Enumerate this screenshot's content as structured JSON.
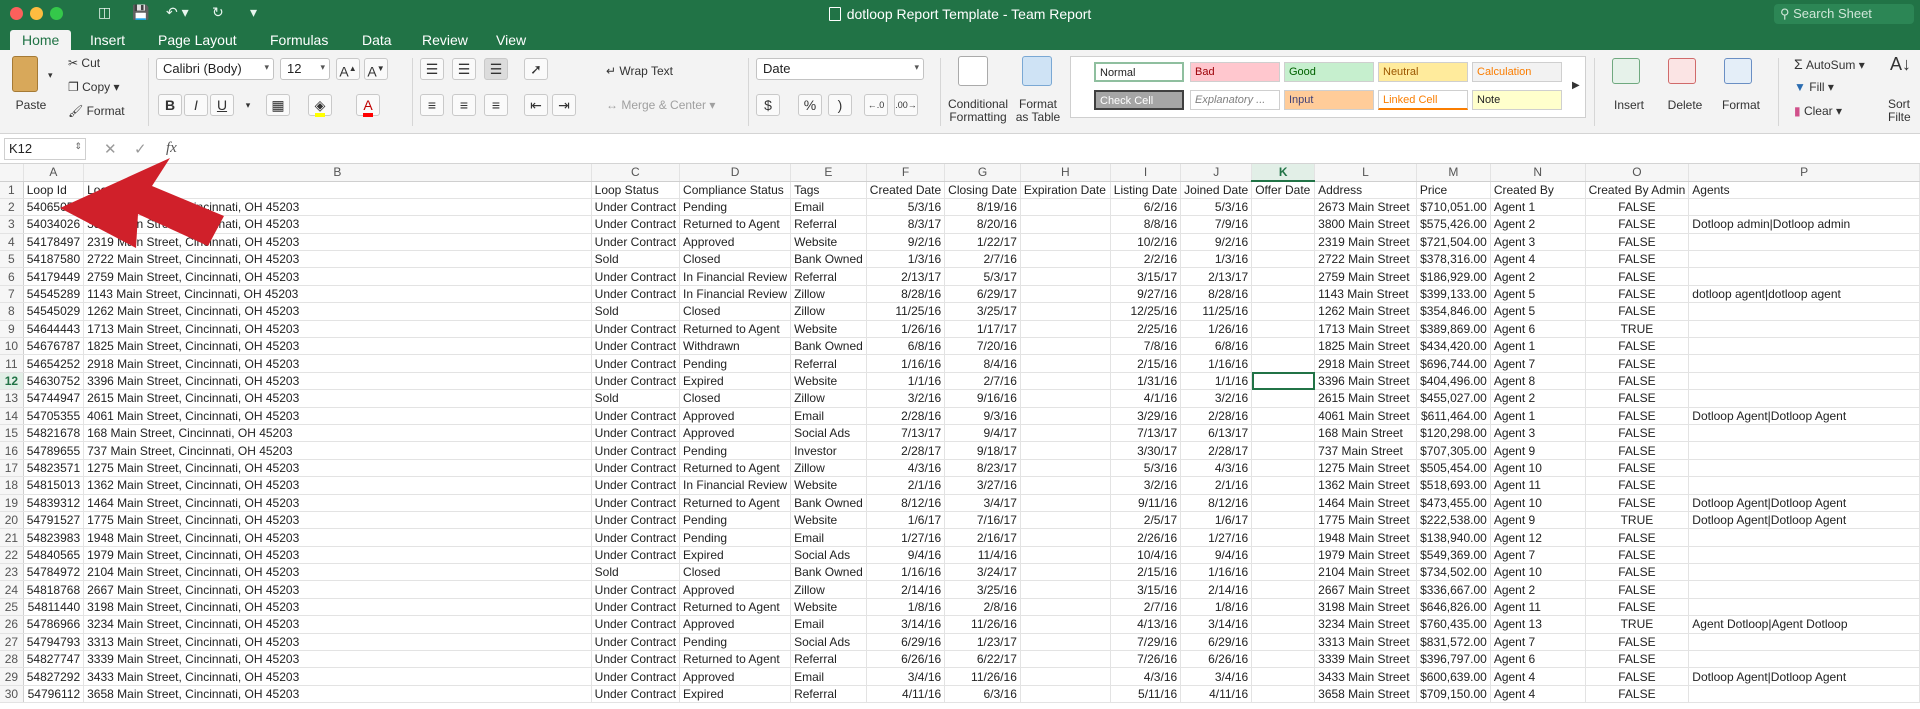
{
  "titlebar": {
    "title": "dotloop Report Template - Team Report",
    "search_placeholder": "Search Sheet",
    "icons": [
      "sidebar-icon",
      "save-icon",
      "undo-icon",
      "redo-icon",
      "customize-icon"
    ]
  },
  "tabs": [
    "Home",
    "Insert",
    "Page Layout",
    "Formulas",
    "Data",
    "Review",
    "View"
  ],
  "active_tab": "Home",
  "ribbon": {
    "paste": "Paste",
    "cut": "Cut",
    "copy": "Copy",
    "format": "Format",
    "font_name": "Calibri (Body)",
    "font_size": "12",
    "bold": "B",
    "italic": "I",
    "underline": "U",
    "wrap_text": "Wrap Text",
    "merge_center": "Merge & Center",
    "number_format": "Date",
    "currency": "$",
    "percent": "%",
    "comma": ")",
    "conditional_formatting_1": "Conditional",
    "conditional_formatting_2": "Formatting",
    "format_table_1": "Format",
    "format_table_2": "as Table",
    "styles": [
      {
        "label": "Normal",
        "bg": "#ffffff",
        "fg": "#222222"
      },
      {
        "label": "Bad",
        "bg": "#ffc7ce",
        "fg": "#9c0006"
      },
      {
        "label": "Good",
        "bg": "#c6efce",
        "fg": "#006100"
      },
      {
        "label": "Neutral",
        "bg": "#ffeb9c",
        "fg": "#9c5700"
      },
      {
        "label": "Calculation",
        "bg": "#f2f2f2",
        "fg": "#fa7d00"
      },
      {
        "label": "Check Cell",
        "bg": "#a5a5a5",
        "fg": "#ffffff"
      },
      {
        "label": "Explanatory ...",
        "bg": "#ffffff",
        "fg": "#7f7f7f"
      },
      {
        "label": "Input",
        "bg": "#ffcc99",
        "fg": "#3f3f76"
      },
      {
        "label": "Linked Cell",
        "bg": "#ffffff",
        "fg": "#fa7d00"
      },
      {
        "label": "Note",
        "bg": "#ffffcc",
        "fg": "#222222"
      }
    ],
    "insert": "Insert",
    "delete": "Delete",
    "format_cells": "Format",
    "autosum": "AutoSum",
    "fill": "Fill",
    "clear": "Clear",
    "sort_1": "Sort",
    "sort_2": "Filte"
  },
  "formula_bar": {
    "name_box": "K12",
    "fx": "fx",
    "content": ""
  },
  "columns": [
    "A",
    "B",
    "C",
    "D",
    "E",
    "F",
    "G",
    "H",
    "I",
    "J",
    "K",
    "L",
    "M",
    "N",
    "O",
    "P"
  ],
  "selected_column": "K",
  "selected_row": 12,
  "headers": [
    "Loop Id",
    "Loop Name",
    "Loop Status",
    "Compliance Status",
    "Tags",
    "Created Date",
    "Closing Date",
    "Expiration Date",
    "Listing Date",
    "Joined Date",
    "Offer Date",
    "Address",
    "Price",
    "Created By",
    "Created By Admin",
    "Agents"
  ],
  "rows": [
    [
      "54065057",
      "2673 Main Street, Cincinnati, OH 45203",
      "Under Contract",
      "Pending",
      "Email",
      "5/3/16",
      "8/19/16",
      "",
      "6/2/16",
      "5/3/16",
      "",
      "2673 Main Street",
      "$710,051.00",
      "Agent 1",
      "FALSE",
      ""
    ],
    [
      "54034026",
      "3800 Main Street, Cincinnati, OH 45203",
      "Under Contract",
      "Returned to Agent",
      "Referral",
      "8/3/17",
      "8/20/16",
      "",
      "8/8/16",
      "7/9/16",
      "",
      "3800 Main Street",
      "$575,426.00",
      "Agent 2",
      "FALSE",
      "Dotloop admin|Dotloop admin"
    ],
    [
      "54178497",
      "2319 Main Street, Cincinnati, OH 45203",
      "Under Contract",
      "Approved",
      "Website",
      "9/2/16",
      "1/22/17",
      "",
      "10/2/16",
      "9/2/16",
      "",
      "2319 Main Street",
      "$721,504.00",
      "Agent 3",
      "FALSE",
      ""
    ],
    [
      "54187580",
      "2722 Main Street, Cincinnati, OH 45203",
      "Sold",
      "Closed",
      "Bank Owned",
      "1/3/16",
      "2/7/16",
      "",
      "2/2/16",
      "1/3/16",
      "",
      "2722 Main Street",
      "$378,316.00",
      "Agent 4",
      "FALSE",
      ""
    ],
    [
      "54179449",
      "2759 Main Street, Cincinnati, OH 45203",
      "Under Contract",
      "In Financial Review",
      "Referral",
      "2/13/17",
      "5/3/17",
      "",
      "3/15/17",
      "2/13/17",
      "",
      "2759 Main Street",
      "$186,929.00",
      "Agent 2",
      "FALSE",
      ""
    ],
    [
      "54545289",
      "1143 Main Street, Cincinnati, OH 45203",
      "Under Contract",
      "In Financial Review",
      "Zillow",
      "8/28/16",
      "6/29/17",
      "",
      "9/27/16",
      "8/28/16",
      "",
      "1143 Main Street",
      "$399,133.00",
      "Agent 5",
      "FALSE",
      "dotloop agent|dotloop agent"
    ],
    [
      "54545029",
      "1262 Main Street, Cincinnati, OH 45203",
      "Sold",
      "Closed",
      "Zillow",
      "11/25/16",
      "3/25/17",
      "",
      "12/25/16",
      "11/25/16",
      "",
      "1262 Main Street",
      "$354,846.00",
      "Agent 5",
      "FALSE",
      ""
    ],
    [
      "54644443",
      "1713 Main Street, Cincinnati, OH 45203",
      "Under Contract",
      "Returned to Agent",
      "Website",
      "1/26/16",
      "1/17/17",
      "",
      "2/25/16",
      "1/26/16",
      "",
      "1713 Main Street",
      "$389,869.00",
      "Agent 6",
      "TRUE",
      ""
    ],
    [
      "54676787",
      "1825 Main Street, Cincinnati, OH 45203",
      "Under Contract",
      "Withdrawn",
      "Bank Owned",
      "6/8/16",
      "7/20/16",
      "",
      "7/8/16",
      "6/8/16",
      "",
      "1825 Main Street",
      "$434,420.00",
      "Agent 1",
      "FALSE",
      ""
    ],
    [
      "54654252",
      "2918 Main Street, Cincinnati, OH 45203",
      "Under Contract",
      "Pending",
      "Referral",
      "1/16/16",
      "8/4/16",
      "",
      "2/15/16",
      "1/16/16",
      "",
      "2918 Main Street",
      "$696,744.00",
      "Agent 7",
      "FALSE",
      ""
    ],
    [
      "54630752",
      "3396 Main Street, Cincinnati, OH 45203",
      "Under Contract",
      "Expired",
      "Website",
      "1/1/16",
      "2/7/16",
      "",
      "1/31/16",
      "1/1/16",
      "",
      "3396 Main Street",
      "$404,496.00",
      "Agent 8",
      "FALSE",
      ""
    ],
    [
      "54744947",
      "2615 Main Street, Cincinnati, OH 45203",
      "Sold",
      "Closed",
      "Zillow",
      "3/2/16",
      "9/16/16",
      "",
      "4/1/16",
      "3/2/16",
      "",
      "2615 Main Street",
      "$455,027.00",
      "Agent 2",
      "FALSE",
      ""
    ],
    [
      "54705355",
      "4061 Main Street, Cincinnati, OH 45203",
      "Under Contract",
      "Approved",
      "Email",
      "2/28/16",
      "9/3/16",
      "",
      "3/29/16",
      "2/28/16",
      "",
      "4061 Main Street",
      "$611,464.00",
      "Agent 1",
      "FALSE",
      "Dotloop Agent|Dotloop Agent"
    ],
    [
      "54821678",
      "168 Main Street, Cincinnati, OH 45203",
      "Under Contract",
      "Approved",
      "Social Ads",
      "7/13/17",
      "9/4/17",
      "",
      "7/13/17",
      "6/13/17",
      "",
      "168 Main Street",
      "$120,298.00",
      "Agent 3",
      "FALSE",
      ""
    ],
    [
      "54789655",
      "737 Main Street, Cincinnati, OH 45203",
      "Under Contract",
      "Pending",
      "Investor",
      "2/28/17",
      "9/18/17",
      "",
      "3/30/17",
      "2/28/17",
      "",
      "737 Main Street",
      "$707,305.00",
      "Agent 9",
      "FALSE",
      ""
    ],
    [
      "54823571",
      "1275 Main Street, Cincinnati, OH 45203",
      "Under Contract",
      "Returned to Agent",
      "Zillow",
      "4/3/16",
      "8/23/17",
      "",
      "5/3/16",
      "4/3/16",
      "",
      "1275 Main Street",
      "$505,454.00",
      "Agent 10",
      "FALSE",
      ""
    ],
    [
      "54815013",
      "1362 Main Street, Cincinnati, OH 45203",
      "Under Contract",
      "In Financial Review",
      "Website",
      "2/1/16",
      "3/27/16",
      "",
      "3/2/16",
      "2/1/16",
      "",
      "1362 Main Street",
      "$518,693.00",
      "Agent 11",
      "FALSE",
      ""
    ],
    [
      "54839312",
      "1464 Main Street, Cincinnati, OH 45203",
      "Under Contract",
      "Returned to Agent",
      "Bank Owned",
      "8/12/16",
      "3/4/17",
      "",
      "9/11/16",
      "8/12/16",
      "",
      "1464 Main Street",
      "$473,455.00",
      "Agent 10",
      "FALSE",
      "Dotloop Agent|Dotloop Agent"
    ],
    [
      "54791527",
      "1775 Main Street, Cincinnati, OH 45203",
      "Under Contract",
      "Pending",
      "Website",
      "1/6/17",
      "7/16/17",
      "",
      "2/5/17",
      "1/6/17",
      "",
      "1775 Main Street",
      "$222,538.00",
      "Agent 9",
      "TRUE",
      "Dotloop Agent|Dotloop Agent"
    ],
    [
      "54823983",
      "1948 Main Street, Cincinnati, OH 45203",
      "Under Contract",
      "Pending",
      "Email",
      "1/27/16",
      "2/16/17",
      "",
      "2/26/16",
      "1/27/16",
      "",
      "1948 Main Street",
      "$138,940.00",
      "Agent 12",
      "FALSE",
      ""
    ],
    [
      "54840565",
      "1979 Main Street, Cincinnati, OH 45203",
      "Under Contract",
      "Expired",
      "Social Ads",
      "9/4/16",
      "11/4/16",
      "",
      "10/4/16",
      "9/4/16",
      "",
      "1979 Main Street",
      "$549,369.00",
      "Agent 7",
      "FALSE",
      ""
    ],
    [
      "54784972",
      "2104 Main Street, Cincinnati, OH 45203",
      "Sold",
      "Closed",
      "Bank Owned",
      "1/16/16",
      "3/24/17",
      "",
      "2/15/16",
      "1/16/16",
      "",
      "2104 Main Street",
      "$734,502.00",
      "Agent 10",
      "FALSE",
      ""
    ],
    [
      "54818768",
      "2667 Main Street, Cincinnati, OH 45203",
      "Under Contract",
      "Approved",
      "Zillow",
      "2/14/16",
      "3/25/16",
      "",
      "3/15/16",
      "2/14/16",
      "",
      "2667 Main Street",
      "$336,667.00",
      "Agent 2",
      "FALSE",
      ""
    ],
    [
      "54811440",
      "3198 Main Street, Cincinnati, OH 45203",
      "Under Contract",
      "Returned to Agent",
      "Website",
      "1/8/16",
      "2/8/16",
      "",
      "2/7/16",
      "1/8/16",
      "",
      "3198 Main Street",
      "$646,826.00",
      "Agent 11",
      "FALSE",
      ""
    ],
    [
      "54786966",
      "3234 Main Street, Cincinnati, OH 45203",
      "Under Contract",
      "Approved",
      "Email",
      "3/14/16",
      "11/26/16",
      "",
      "4/13/16",
      "3/14/16",
      "",
      "3234 Main Street",
      "$760,435.00",
      "Agent 13",
      "TRUE",
      "Agent Dotloop|Agent Dotloop"
    ],
    [
      "54794793",
      "3313 Main Street, Cincinnati, OH 45203",
      "Under Contract",
      "Pending",
      "Social Ads",
      "6/29/16",
      "1/23/17",
      "",
      "7/29/16",
      "6/29/16",
      "",
      "3313 Main Street",
      "$831,572.00",
      "Agent 7",
      "FALSE",
      ""
    ],
    [
      "54827747",
      "3339 Main Street, Cincinnati, OH 45203",
      "Under Contract",
      "Returned to Agent",
      "Referral",
      "6/26/16",
      "6/22/17",
      "",
      "7/26/16",
      "6/26/16",
      "",
      "3339 Main Street",
      "$396,797.00",
      "Agent 6",
      "FALSE",
      ""
    ],
    [
      "54827292",
      "3433 Main Street, Cincinnati, OH 45203",
      "Under Contract",
      "Approved",
      "Email",
      "3/4/16",
      "11/26/16",
      "",
      "4/3/16",
      "3/4/16",
      "",
      "3433 Main Street",
      "$600,639.00",
      "Agent 4",
      "FALSE",
      "Dotloop Agent|Dotloop Agent"
    ],
    [
      "54796112",
      "3658 Main Street, Cincinnati, OH 45203",
      "Under Contract",
      "Expired",
      "Referral",
      "4/11/16",
      "6/3/16",
      "",
      "5/11/16",
      "4/11/16",
      "",
      "3658 Main Street",
      "$709,150.00",
      "Agent 4",
      "FALSE",
      ""
    ]
  ],
  "colors": {
    "excel_green": "#217346",
    "annotation_arrow": "#d0202a"
  }
}
